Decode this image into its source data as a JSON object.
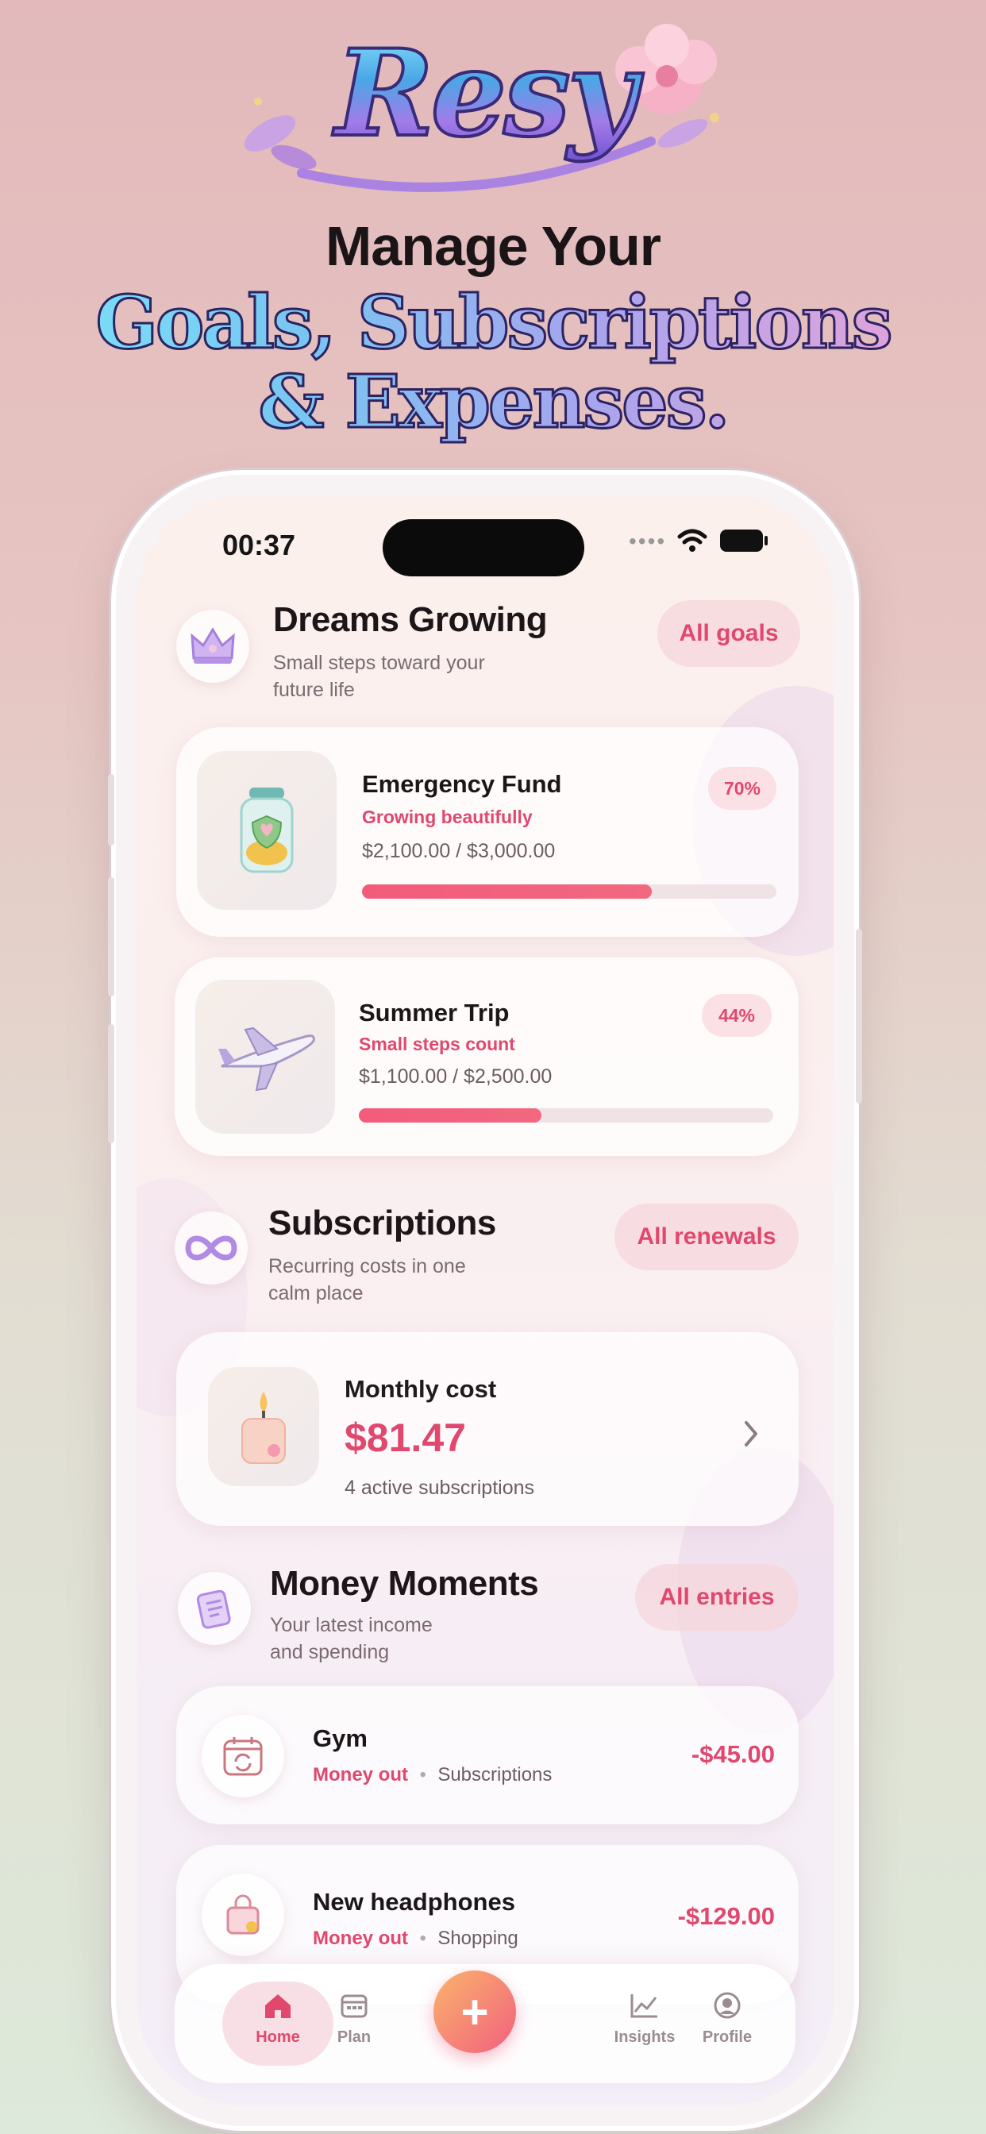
{
  "hero": {
    "logo": "Resy",
    "headline": "Manage Your",
    "line1": "Goals, Subscriptions",
    "line2": "& Expenses."
  },
  "status_bar": {
    "time": "00:37"
  },
  "goals_section": {
    "title": "Dreams Growing",
    "subtitle_line1": "Small steps toward your",
    "subtitle_line2": "future life",
    "action": "All goals",
    "icon": "crown-icon",
    "items": [
      {
        "name": "Emergency Fund",
        "tag": "Growing beautifully",
        "amount": "$2,100.00 / $3,000.00",
        "percent_label": "70%",
        "progress": 0.7,
        "icon": "savings-jar-icon"
      },
      {
        "name": "Summer Trip",
        "tag": "Small steps count",
        "amount": "$1,100.00 / $2,500.00",
        "percent_label": "44%",
        "progress": 0.44,
        "icon": "airplane-icon"
      }
    ]
  },
  "subscriptions_section": {
    "title": "Subscriptions",
    "subtitle_line1": "Recurring costs in one",
    "subtitle_line2": "calm place",
    "action": "All renewals",
    "icon": "infinity-icon",
    "card": {
      "label": "Monthly cost",
      "value": "$81.47",
      "detail": "4 active subscriptions",
      "icon": "candle-icon"
    }
  },
  "moments_section": {
    "title": "Money Moments",
    "subtitle_line1": "Your latest income",
    "subtitle_line2": "and spending",
    "action": "All entries",
    "icon": "notepad-icon",
    "items": [
      {
        "name": "Gym",
        "direction": "Money out",
        "category": "Subscriptions",
        "amount": "-$45.00",
        "icon": "calendar-repeat-icon"
      },
      {
        "name": "New headphones",
        "direction": "Money out",
        "category": "Shopping",
        "amount": "-$129.00",
        "icon": "shopping-bag-icon"
      }
    ]
  },
  "tabbar": {
    "tabs": [
      {
        "label": "Home",
        "icon": "home-icon",
        "active": true
      },
      {
        "label": "Plan",
        "icon": "calendar-icon"
      },
      {
        "label": "Insights",
        "icon": "chart-icon"
      },
      {
        "label": "Profile",
        "icon": "profile-icon"
      }
    ],
    "fab_symbol": "+"
  },
  "colors": {
    "accent": "#e0486e",
    "progress": "#f25c7a"
  }
}
